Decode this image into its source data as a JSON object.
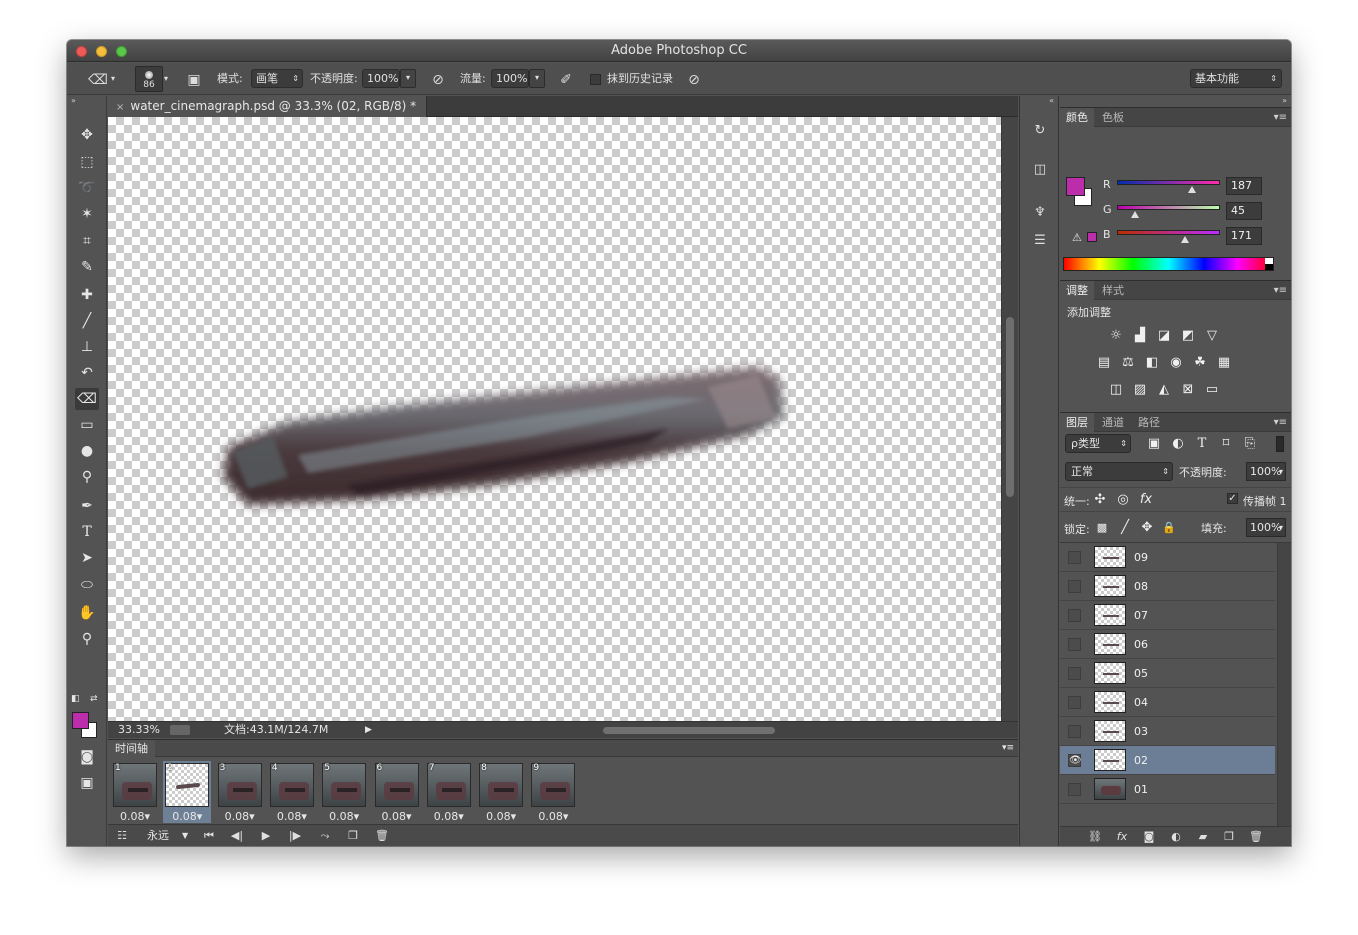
{
  "app": {
    "title": "Adobe Photoshop CC"
  },
  "options_bar": {
    "brush_size": "86",
    "mode_label": "模式:",
    "mode_value": "画笔",
    "opacity_label": "不透明度:",
    "opacity_value": "100%",
    "flow_label": "流量:",
    "flow_value": "100%",
    "erase_history_label": "抹到历史记录",
    "workspace": "基本功能"
  },
  "document": {
    "tab_title": "water_cinemagraph.psd @ 33.3% (02, RGB/8) *",
    "zoom": "33.33%",
    "doc_info": "文档:43.1M/124.7M"
  },
  "timeline": {
    "title": "时间轴",
    "loop": "永远",
    "frames": [
      {
        "num": "1",
        "delay": "0.08▾"
      },
      {
        "num": "2",
        "delay": "0.08▾"
      },
      {
        "num": "3",
        "delay": "0.08▾"
      },
      {
        "num": "4",
        "delay": "0.08▾"
      },
      {
        "num": "5",
        "delay": "0.08▾"
      },
      {
        "num": "6",
        "delay": "0.08▾"
      },
      {
        "num": "7",
        "delay": "0.08▾"
      },
      {
        "num": "8",
        "delay": "0.08▾"
      },
      {
        "num": "9",
        "delay": "0.08▾"
      }
    ],
    "selected_frame": 2
  },
  "color_panel": {
    "tabs": [
      "颜色",
      "色板"
    ],
    "r_label": "R",
    "g_label": "G",
    "b_label": "B",
    "r": "187",
    "g": "45",
    "b": "171",
    "foreground": "#bb2dab"
  },
  "adjustments_panel": {
    "tabs": [
      "调整",
      "样式"
    ],
    "heading": "添加调整"
  },
  "layers_panel": {
    "tabs": [
      "图层",
      "通道",
      "路径"
    ],
    "filter_kind": "ρ类型",
    "blend_mode": "正常",
    "opacity_label": "不透明度:",
    "opacity_value": "100%",
    "unify_label": "统一:",
    "propagate_label": "传播帧 1",
    "lock_label": "锁定:",
    "fill_label": "填充:",
    "fill_value": "100%",
    "layers": [
      {
        "name": "09",
        "visible": false,
        "selected": false
      },
      {
        "name": "08",
        "visible": false,
        "selected": false
      },
      {
        "name": "07",
        "visible": false,
        "selected": false
      },
      {
        "name": "06",
        "visible": false,
        "selected": false
      },
      {
        "name": "05",
        "visible": false,
        "selected": false
      },
      {
        "name": "04",
        "visible": false,
        "selected": false
      },
      {
        "name": "03",
        "visible": false,
        "selected": false
      },
      {
        "name": "02",
        "visible": true,
        "selected": true
      },
      {
        "name": "01",
        "visible": false,
        "selected": false
      }
    ]
  },
  "icons": {
    "eraser": "eraser-icon",
    "eye": "eye-icon"
  }
}
